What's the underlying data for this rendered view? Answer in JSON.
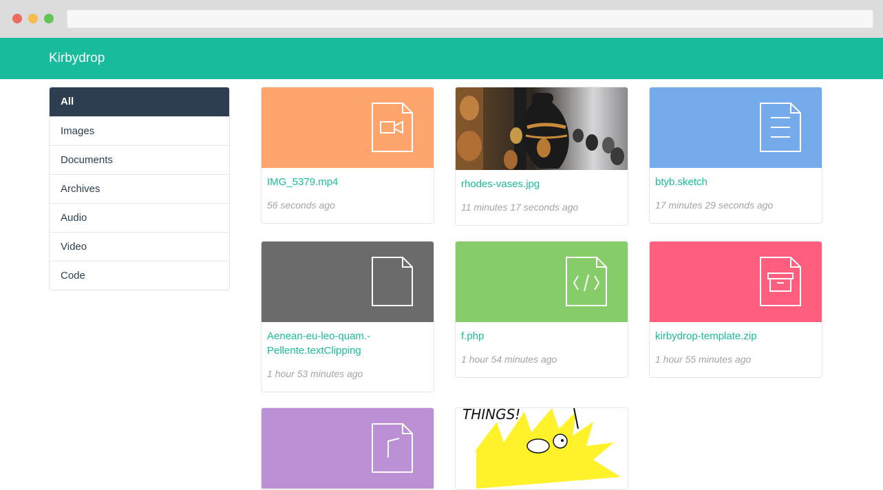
{
  "app": {
    "title": "Kirbydrop"
  },
  "sidebar": {
    "items": [
      {
        "label": "All",
        "active": true
      },
      {
        "label": "Images"
      },
      {
        "label": "Documents"
      },
      {
        "label": "Archives"
      },
      {
        "label": "Audio"
      },
      {
        "label": "Video"
      },
      {
        "label": "Code"
      }
    ]
  },
  "files": [
    {
      "name": "IMG_5379.mp4",
      "time": "56 seconds ago",
      "kind": "video",
      "color": "#fea56d",
      "icon": "video-file-icon"
    },
    {
      "name": "rhodes-vases.jpg",
      "time": "11 minutes 17 seconds ago",
      "kind": "image",
      "icon": "photo-thumbnail"
    },
    {
      "name": "btyb.sketch",
      "time": "17 minutes 29 seconds ago",
      "kind": "document",
      "color": "#75aaeb",
      "icon": "document-file-icon"
    },
    {
      "name": "Aenean-eu-leo-quam.-Pellente.textClipping",
      "time": "1 hour 53 minutes ago",
      "kind": "generic",
      "color": "#6b6b6b",
      "icon": "blank-file-icon"
    },
    {
      "name": "f.php",
      "time": "1 hour 54 minutes ago",
      "kind": "code",
      "color": "#86cd6a",
      "icon": "code-file-icon"
    },
    {
      "name": "kirbydrop-template.zip",
      "time": "1 hour 55 minutes ago",
      "kind": "archive",
      "color": "#fe5f7f",
      "icon": "archive-file-icon"
    },
    {
      "kind": "audio",
      "color": "#bb90d4",
      "icon": "audio-file-icon"
    },
    {
      "kind": "image",
      "image_text": "THINGS!",
      "icon": "comic-thumbnail"
    }
  ],
  "colors": {
    "accent": "#18bc9c",
    "sidebar_active": "#2c3e50"
  }
}
